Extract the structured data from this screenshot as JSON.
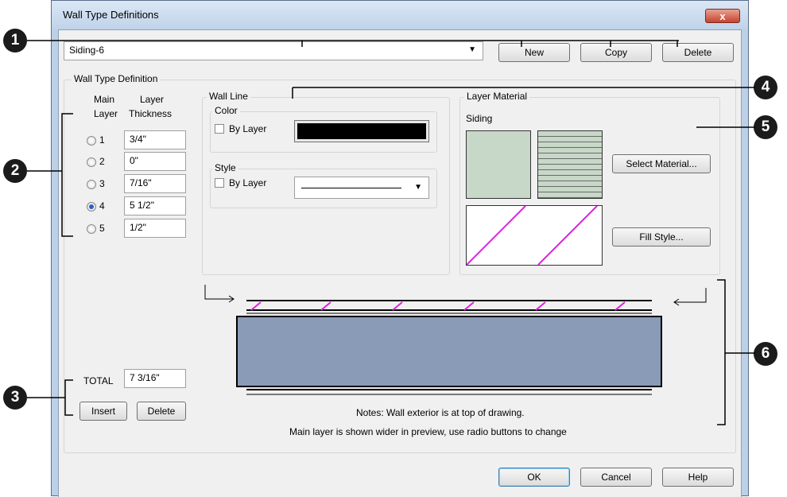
{
  "window": {
    "title": "Wall Type Definitions",
    "close_glyph": "x"
  },
  "top": {
    "selected_wall_type": "Siding-6",
    "new_label": "New",
    "copy_label": "Copy",
    "delete_label": "Delete"
  },
  "definition": {
    "group_label": "Wall Type Definition",
    "col_main": "Main",
    "col_main2": "Layer",
    "col_layer": "Layer",
    "col_layer2": "Thickness",
    "layers": [
      {
        "num": "1",
        "thickness": "3/4\"",
        "selected": false
      },
      {
        "num": "2",
        "thickness": "0\"",
        "selected": false
      },
      {
        "num": "3",
        "thickness": "7/16\"",
        "selected": false
      },
      {
        "num": "4",
        "thickness": "5 1/2\"",
        "selected": true
      },
      {
        "num": "5",
        "thickness": "1/2\"",
        "selected": false
      }
    ],
    "total_label": "TOTAL",
    "total_value": "7 3/16\"",
    "insert_label": "Insert",
    "delete_label": "Delete"
  },
  "wall_line": {
    "group_label": "Wall Line",
    "color_label": "Color",
    "color_bylayer": "By Layer",
    "color_value": "#000000",
    "style_label": "Style",
    "style_bylayer": "By Layer"
  },
  "material": {
    "group_label": "Layer Material",
    "name": "Siding",
    "select_label": "Select Material...",
    "fill_label": "Fill Style...",
    "swatch_color": "#c8d8c8",
    "hatch_color": "#e020e0"
  },
  "preview": {
    "note1": "Notes:  Wall exterior is at top of drawing.",
    "note2": "Main layer is shown wider in preview, use radio buttons to change",
    "main_color": "#8a9bb8"
  },
  "footer": {
    "ok_label": "OK",
    "cancel_label": "Cancel",
    "help_label": "Help"
  },
  "callouts": [
    "1",
    "2",
    "3",
    "4",
    "5",
    "6"
  ]
}
